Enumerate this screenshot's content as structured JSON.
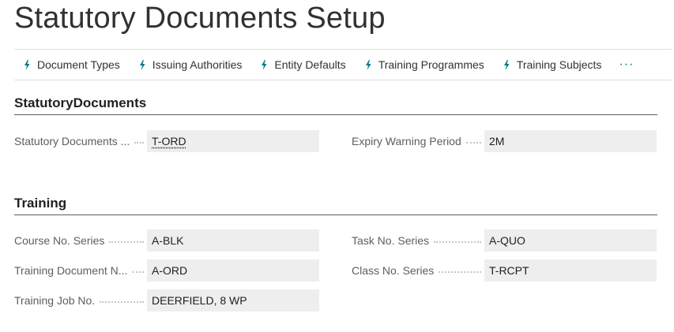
{
  "page": {
    "title": "Statutory Documents Setup"
  },
  "actions": [
    {
      "label": "Document Types",
      "icon": "lightning-icon"
    },
    {
      "label": "Issuing Authorities",
      "icon": "lightning-icon"
    },
    {
      "label": "Entity Defaults",
      "icon": "lightning-icon"
    },
    {
      "label": "Training Programmes",
      "icon": "lightning-icon"
    },
    {
      "label": "Training Subjects",
      "icon": "lightning-icon"
    }
  ],
  "more_label": "···",
  "sections": {
    "statutory": {
      "title": "StatutoryDocuments",
      "fields": {
        "statutory_docs": {
          "label": "Statutory Documents ...",
          "value": "T-ORD"
        },
        "expiry_warning": {
          "label": "Expiry Warning Period",
          "value": "2M"
        }
      }
    },
    "training": {
      "title": "Training",
      "fields": {
        "course_no": {
          "label": "Course No. Series",
          "value": "A-BLK"
        },
        "task_no": {
          "label": "Task No. Series",
          "value": "A-QUO"
        },
        "training_doc": {
          "label": "Training Document N...",
          "value": "A-ORD"
        },
        "class_no": {
          "label": "Class No. Series",
          "value": "T-RCPT"
        },
        "training_job": {
          "label": "Training Job No.",
          "value": "DEERFIELD, 8 WP"
        }
      }
    }
  },
  "colors": {
    "accent": "#00788a",
    "field_bg": "#eeeeee",
    "label": "#605e5c"
  }
}
